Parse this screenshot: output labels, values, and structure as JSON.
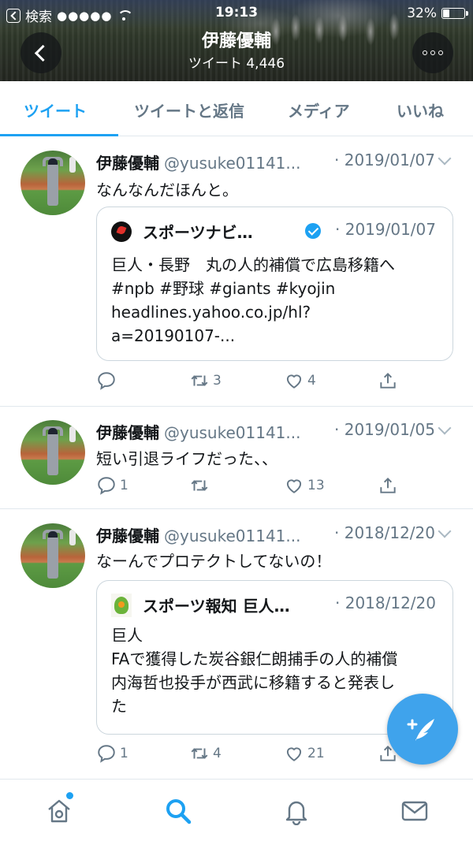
{
  "status_bar": {
    "back_app_label": "検索",
    "signal": "●●●●●",
    "time": "19:13",
    "battery_percent_label": "32%",
    "battery_level": 0.32
  },
  "profile": {
    "name": "伊藤優輔",
    "tweet_count_label": "ツイート 4,446"
  },
  "tabs": [
    {
      "label": "ツイート",
      "active": true
    },
    {
      "label": "ツイートと返信",
      "active": false
    },
    {
      "label": "メディア",
      "active": false
    },
    {
      "label": "いいね",
      "active": false
    }
  ],
  "tweets": [
    {
      "name": "伊藤優輔",
      "handle": "@yusuke01141...",
      "date": "· 2019/01/07",
      "text": "なんなんだほんと。",
      "quote": {
        "name": "スポーツナビ…",
        "verified": true,
        "date": "· 2019/01/07",
        "lines": [
          "巨人・長野　丸の人的補償で広島移籍へ",
          "#npb #野球 #giants #kyojin",
          "headlines.yahoo.co.jp/hl?",
          "a=20190107-..."
        ]
      },
      "reply_count": "",
      "retweet_count": "3",
      "like_count": "4"
    },
    {
      "name": "伊藤優輔",
      "handle": "@yusuke01141...",
      "date": "· 2019/01/05",
      "text": "短い引退ライフだった、、",
      "reply_count": "1",
      "retweet_count": "",
      "like_count": "13"
    },
    {
      "name": "伊藤優輔",
      "handle": "@yusuke01141...",
      "date": "· 2018/12/20",
      "text": "なーんでプロテクトしてないの！",
      "quote": {
        "name": "スポーツ報知 巨人…",
        "verified": false,
        "date": "· 2018/12/20",
        "lines": [
          "巨人",
          "FAで獲得した炭谷銀仁朗捕手の人的補償",
          "内海哲也投手が西武に移籍すると発表し",
          "た"
        ]
      },
      "reply_count": "1",
      "retweet_count": "4",
      "like_count": "21"
    }
  ],
  "colors": {
    "accent": "#1da1f2",
    "secondary_text": "#657786",
    "border": "#e1e8ed",
    "fab": "#3fa3ec"
  },
  "bottom_nav": [
    "home-icon",
    "search-icon",
    "bell-icon",
    "mail-icon"
  ]
}
